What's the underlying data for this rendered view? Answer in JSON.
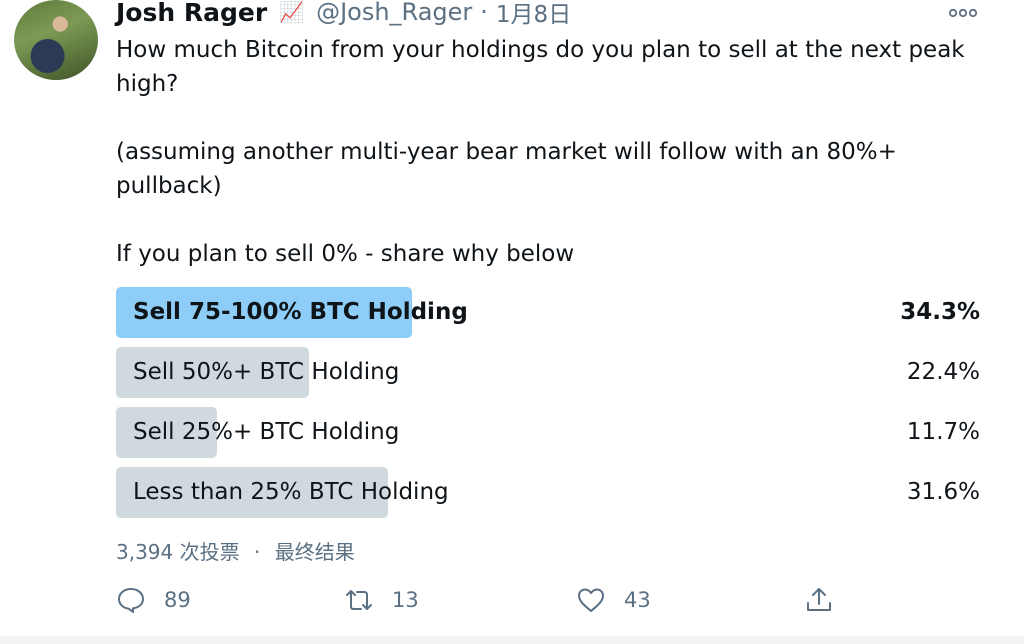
{
  "tweet": {
    "display_name": "Josh Rager",
    "emoji": "📈",
    "handle": "@Josh_Rager",
    "separator": "·",
    "date": "1月8日",
    "more_icon": "more-horizontal-icon",
    "text_line1": "How much Bitcoin from your holdings do you plan to sell at the next peak high?",
    "text_line2": "(assuming another multi-year bear market will follow with an 80%+ pullback)",
    "text_line3": "If you plan to sell 0% - share why below"
  },
  "poll": {
    "options": [
      {
        "label": "Sell 75-100% BTC Holding",
        "percent_text": "34.3%",
        "percent": 34.3,
        "winner": true
      },
      {
        "label": "Sell 50%+ BTC Holding",
        "percent_text": "22.4%",
        "percent": 22.4,
        "winner": false
      },
      {
        "label": "Sell 25%+ BTC Holding",
        "percent_text": "11.7%",
        "percent": 11.7,
        "winner": false
      },
      {
        "label": "Less than 25% BTC Holding",
        "percent_text": "31.6%",
        "percent": 31.6,
        "winner": false
      }
    ],
    "votes_text": "3,394 次投票",
    "separator": "·",
    "status_text": "最终结果"
  },
  "actions": {
    "reply_count": "89",
    "retweet_count": "13",
    "like_count": "43",
    "icons": [
      "reply-icon",
      "retweet-icon",
      "like-icon",
      "share-icon"
    ]
  },
  "colors": {
    "winner_bar": "#8ecdf8",
    "bar": "#cfd9de",
    "secondary_text": "#5b7083"
  }
}
